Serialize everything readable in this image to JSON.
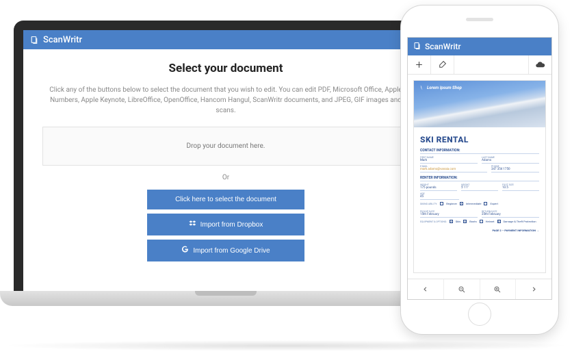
{
  "app_name": "ScanWritr",
  "laptop": {
    "title": "Select your document",
    "description": "Click any of the buttons below to select the document that you wish to edit. You can edit PDF, Microsoft Office, Apple Numbers, Apple Keynote, LibreOffice, OpenOffice, Hancom Hangul, ScanWritr documents, and JPEG, GIF images and scans.",
    "dropzone": "Drop your document here.",
    "or": "Or",
    "buttons": {
      "select": "Click here to select the document",
      "dropbox": "Import from Dropbox",
      "gdrive": "Import from Google Drive"
    }
  },
  "phone": {
    "doc": {
      "hero_brand": "Lorem Ipsum Shop",
      "title": "SKI RENTAL",
      "sections": {
        "contact": "CONTACT INFORMATION:",
        "renter": "RENTER INFORMATION:"
      },
      "fields": {
        "first_name_lbl": "FIRST NAME",
        "first_name": "Mark",
        "last_name_lbl": "LAST NAME",
        "last_name": "Adams",
        "email_lbl": "E-MAIL",
        "email": "mark.adams@vanaia.com",
        "phone_lbl": "PHONE",
        "phone": "347 354 1750",
        "weight_lbl": "WEIGHT",
        "weight": "175 pounds",
        "height_lbl": "HEIGHT",
        "height": "5' 11\"",
        "foot_lbl": "FOOT SIZE",
        "foot": "10.5",
        "age_lbl": "AGE",
        "age": "45",
        "ability_lbl": "SKIING ABILITY:",
        "ability_opts": [
          "Beginner",
          "Intermediate",
          "Expert"
        ],
        "pickup_lbl": "PICKUP DATE",
        "pickup": "15th February",
        "return_lbl": "RETURN DATE",
        "return": "25th February",
        "equip_lbl": "EQUIPMENT & OPTIONS:",
        "equip_opts": [
          "Skis",
          "Boots",
          "Helmet",
          "Damage & Theft Protection"
        ]
      },
      "footer": "PAGE 2 – PAYMENT INFORMATION  →"
    }
  }
}
